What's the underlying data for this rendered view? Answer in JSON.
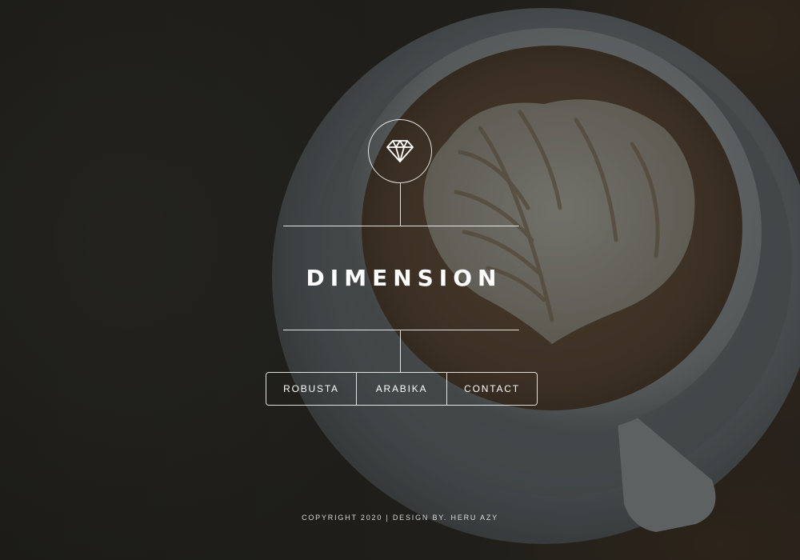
{
  "header": {
    "logo_icon": "diamond-icon",
    "title": "DIMENSION"
  },
  "nav": {
    "items": [
      {
        "label": "ROBUSTA"
      },
      {
        "label": "ARABIKA"
      },
      {
        "label": "CONTACT"
      }
    ]
  },
  "footer": {
    "copyright": "COPYRIGHT 2020 | DESIGN BY. HERU AZY"
  },
  "colors": {
    "text": "#ffffff",
    "background": "#1e1d1a",
    "line": "#ffffff"
  }
}
